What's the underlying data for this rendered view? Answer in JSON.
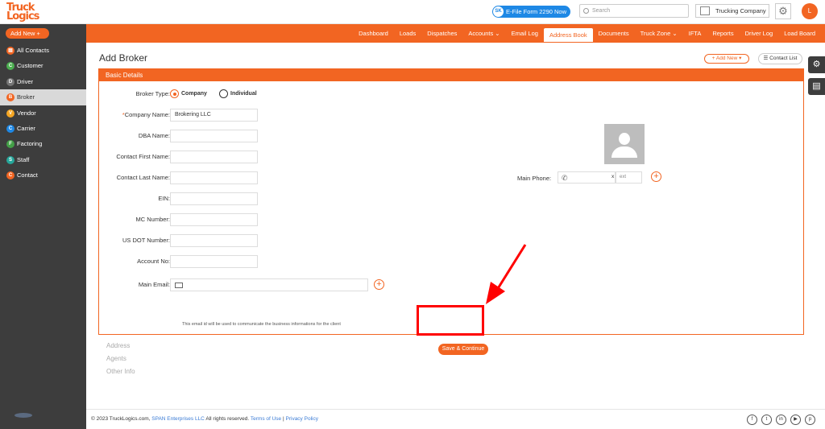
{
  "header": {
    "logo_line1": "Truck",
    "logo_line2": "Logics",
    "efile_badge": "SK",
    "efile_label": "E-File Form 2290 Now",
    "search_placeholder": "Search",
    "company_name": "Trucking Company",
    "avatar_initial": "L"
  },
  "toolbar": {
    "add_new": "Add New"
  },
  "nav": [
    "Dashboard",
    "Loads",
    "Dispatches",
    "Accounts ⌄",
    "Email Log",
    "Address Book",
    "Documents",
    "Truck Zone ⌄",
    "IFTA",
    "Reports",
    "Driver Log",
    "Load Board"
  ],
  "nav_active": "Address Book",
  "sidebar": {
    "items": [
      {
        "label": "All Contacts",
        "badge": "▤",
        "color": "#f26522"
      },
      {
        "label": "Customer",
        "badge": "C",
        "color": "#4caf50"
      },
      {
        "label": "Driver",
        "badge": "D",
        "color": "#757575"
      },
      {
        "label": "Broker",
        "badge": "B",
        "color": "#f26522"
      },
      {
        "label": "Vendor",
        "badge": "V",
        "color": "#f5a623"
      },
      {
        "label": "Carrier",
        "badge": "C",
        "color": "#1e88e5"
      },
      {
        "label": "Factoring",
        "badge": "F",
        "color": "#43a047"
      },
      {
        "label": "Staff",
        "badge": "S",
        "color": "#26a69a"
      },
      {
        "label": "Contact",
        "badge": "C",
        "color": "#f26522"
      }
    ]
  },
  "page": {
    "title": "Add Broker",
    "add_new_small": "+ Add New ▾",
    "contact_list": "☰ Contact List",
    "section_title": "Basic Details"
  },
  "form": {
    "broker_type_label": "Broker Type:",
    "type_company": "Company",
    "type_individual": "Individual",
    "company_name_label": "Company Name:",
    "company_name_value": "Brokering LLC",
    "dba_label": "DBA Name:",
    "first_name_label": "Contact First Name:",
    "last_name_label": "Contact Last Name:",
    "ein_label": "EIN:",
    "mc_label": "MC Number:",
    "usdot_label": "US DOT Number:",
    "account_label": "Account No:",
    "email_label": "Main Email:",
    "email_note": "This email id will be used to communicate the business informations for the client",
    "phone_label": "Main Phone:",
    "ext_x": "x",
    "ext_placeholder": "ext"
  },
  "actions": {
    "save": "Save & Continue"
  },
  "sections": [
    "Address",
    "Agents",
    "Other Info"
  ],
  "footer": {
    "copyright": "© 2023 TruckLogics.com,",
    "company_link": "SPAN Enterprises LLC",
    "rights": "All rights reserved.",
    "terms": "Terms of Use",
    "sep": "|",
    "privacy": "Privacy Policy",
    "socials": [
      "f",
      "t",
      "in",
      "▶",
      "p"
    ]
  },
  "colors": {
    "brand": "#f26522",
    "sidebar_bg": "#3d3d3d",
    "annotation_red": "#ff0000"
  }
}
